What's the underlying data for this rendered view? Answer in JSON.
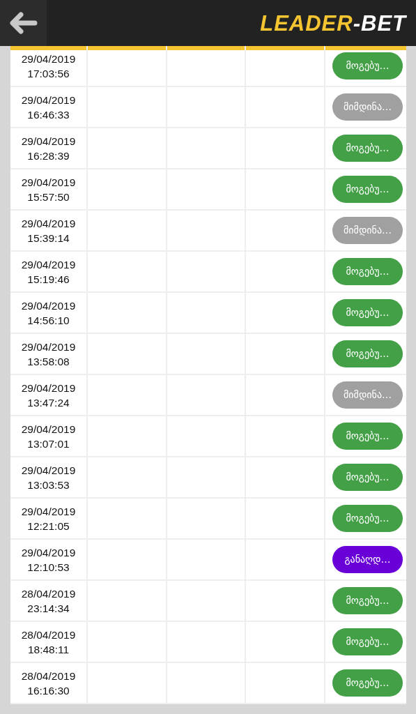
{
  "header": {
    "logo_primary": "LEADER",
    "logo_secondary": "-BET"
  },
  "rows": [
    {
      "date": "29/04/2019",
      "time": "17:03:56",
      "status": "მოგებუ…",
      "color": "#43a047"
    },
    {
      "date": "29/04/2019",
      "time": "16:46:33",
      "status": "მიმდინა…",
      "color": "#a0a0a0"
    },
    {
      "date": "29/04/2019",
      "time": "16:28:39",
      "status": "მოგებუ…",
      "color": "#43a047"
    },
    {
      "date": "29/04/2019",
      "time": "15:57:50",
      "status": "მოგებუ…",
      "color": "#43a047"
    },
    {
      "date": "29/04/2019",
      "time": "15:39:14",
      "status": "მიმდინა…",
      "color": "#a0a0a0"
    },
    {
      "date": "29/04/2019",
      "time": "15:19:46",
      "status": "მოგებუ…",
      "color": "#43a047"
    },
    {
      "date": "29/04/2019",
      "time": "14:56:10",
      "status": "მოგებუ…",
      "color": "#43a047"
    },
    {
      "date": "29/04/2019",
      "time": "13:58:08",
      "status": "მოგებუ…",
      "color": "#43a047"
    },
    {
      "date": "29/04/2019",
      "time": "13:47:24",
      "status": "მიმდინა…",
      "color": "#a0a0a0"
    },
    {
      "date": "29/04/2019",
      "time": "13:07:01",
      "status": "მოგებუ…",
      "color": "#43a047"
    },
    {
      "date": "29/04/2019",
      "time": "13:03:53",
      "status": "მოგებუ…",
      "color": "#43a047"
    },
    {
      "date": "29/04/2019",
      "time": "12:21:05",
      "status": "მოგებუ…",
      "color": "#43a047"
    },
    {
      "date": "29/04/2019",
      "time": "12:10:53",
      "status": "განაღდ…",
      "color": "#6a00d8"
    },
    {
      "date": "28/04/2019",
      "time": "23:14:34",
      "status": "მოგებუ…",
      "color": "#43a047"
    },
    {
      "date": "28/04/2019",
      "time": "18:48:11",
      "status": "მოგებუ…",
      "color": "#43a047"
    },
    {
      "date": "28/04/2019",
      "time": "16:16:30",
      "status": "მოგებუ…",
      "color": "#43a047"
    }
  ]
}
